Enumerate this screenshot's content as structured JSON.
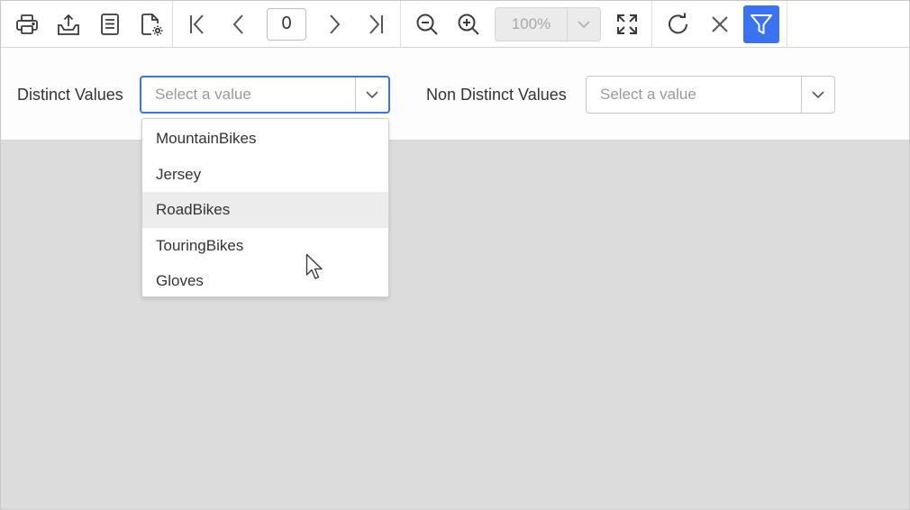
{
  "toolbar": {
    "buttons": [
      {
        "name": "print-icon"
      },
      {
        "name": "export-icon"
      },
      {
        "name": "document-icon"
      },
      {
        "name": "page-setup-icon"
      },
      {
        "name": "first-page-icon"
      },
      {
        "name": "previous-page-icon"
      },
      {
        "name": "next-page-icon"
      },
      {
        "name": "last-page-icon"
      },
      {
        "name": "zoom-out-icon"
      },
      {
        "name": "zoom-in-icon"
      },
      {
        "name": "fit-page-icon"
      },
      {
        "name": "refresh-icon"
      },
      {
        "name": "close-icon"
      },
      {
        "name": "filter-icon"
      }
    ],
    "page_number": "0",
    "zoom_value": "100%",
    "accent_color": "#3b72f0"
  },
  "parameters": {
    "distinct": {
      "label": "Distinct Values",
      "placeholder": "Select a value"
    },
    "non_distinct": {
      "label": "Non Distinct Values",
      "placeholder": "Select a value"
    }
  },
  "dropdown": {
    "items": [
      "MountainBikes",
      "Jersey",
      "RoadBikes",
      "TouringBikes",
      "Gloves"
    ],
    "hovered": "RoadBikes"
  }
}
